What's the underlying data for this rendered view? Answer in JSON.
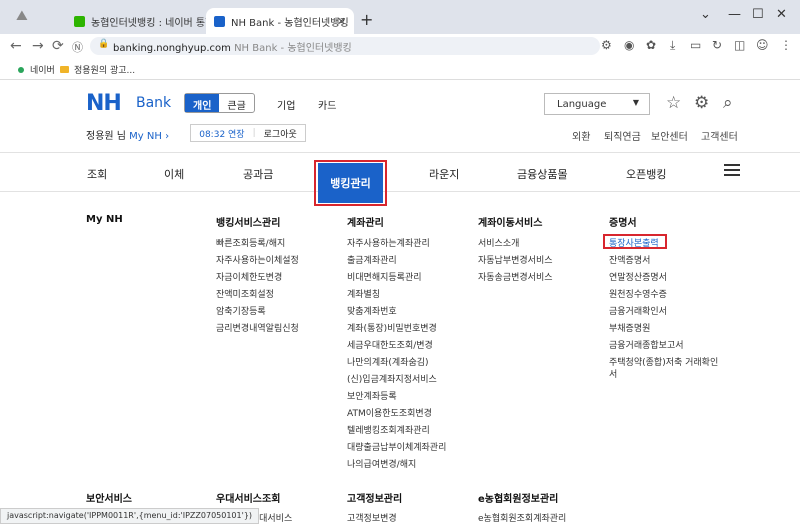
{
  "browser": {
    "tabs": [
      {
        "label": "농협인터넷뱅킹 : 네이버 통합검"
      },
      {
        "label": "NH Bank - 농협인터넷뱅킹"
      }
    ],
    "url": "banking.nonghyup.com",
    "url_title": "NH Bank - 농협인터넷뱅킹",
    "bookmarks": [
      "네이버",
      "정용원의 광고..."
    ],
    "status_text": "javascript:navigate('IPPM0011R',{menu_id:'IPZZ07050101'})"
  },
  "header": {
    "logo": "NH",
    "logo_sub": "Bank",
    "segments": [
      "개인",
      "큰글"
    ],
    "links": [
      "기업",
      "카드"
    ],
    "language": "Language",
    "user": "정용원 님",
    "mynh": "My NH",
    "session_time": "08:32 연장",
    "logout": "로그아웃",
    "util_links": [
      "외환",
      "퇴직연금",
      "보안센터",
      "고객센터"
    ]
  },
  "gnb": {
    "items": [
      "조회",
      "이체",
      "공과금",
      "뱅킹관리",
      "라운지",
      "금융상품몰",
      "오픈뱅킹"
    ]
  },
  "mega": {
    "columns": [
      {
        "title": "My NH",
        "links": []
      },
      {
        "title": "뱅킹서비스관리",
        "links": [
          "빠른조회등록/해지",
          "자주사용하는이체설정",
          "자금이체한도변경",
          "잔액미조회설정",
          "암축기장등록",
          "금리변경내역알림신청"
        ]
      },
      {
        "title": "계좌관리",
        "links": [
          "자주사용하는계좌관리",
          "출금계좌관리",
          "비대면해지등록관리",
          "계좌별칭",
          "맞춤계좌번호",
          "계좌(통장)비밀번호변경",
          "세금우대한도조회/변경",
          "나만의계좌(계좌숨김)",
          "(신)입금계좌지정서비스",
          "보안계좌등록",
          "ATM이용한도조회변경",
          "텔레뱅킹조회계좌관리",
          "대량출금납부이체계좌관리",
          "나의급여변경/해지"
        ]
      },
      {
        "title": "계좌이동서비스",
        "links": [
          "서비스소개",
          "자동납부변경서비스",
          "자동송금변경서비스"
        ]
      },
      {
        "title": "증명서",
        "links": [
          "통장사본출력",
          "잔액증명서",
          "연말정산증명서",
          "원천징수영수증",
          "금융거래확인서",
          "부채증명원",
          "금융거래종합보고서",
          "주택청약(종합)저축 거래확인",
          "서"
        ]
      }
    ],
    "bottom": [
      {
        "title": "보안서비스",
        "link": ""
      },
      {
        "title": "우대서비스조회",
        "link": "협은행우대서비스"
      },
      {
        "title": "고객정보관리",
        "link": "고객정보변경"
      },
      {
        "title": "e농협회원정보관리",
        "link": "e농협회원조회계좌관리"
      }
    ]
  }
}
